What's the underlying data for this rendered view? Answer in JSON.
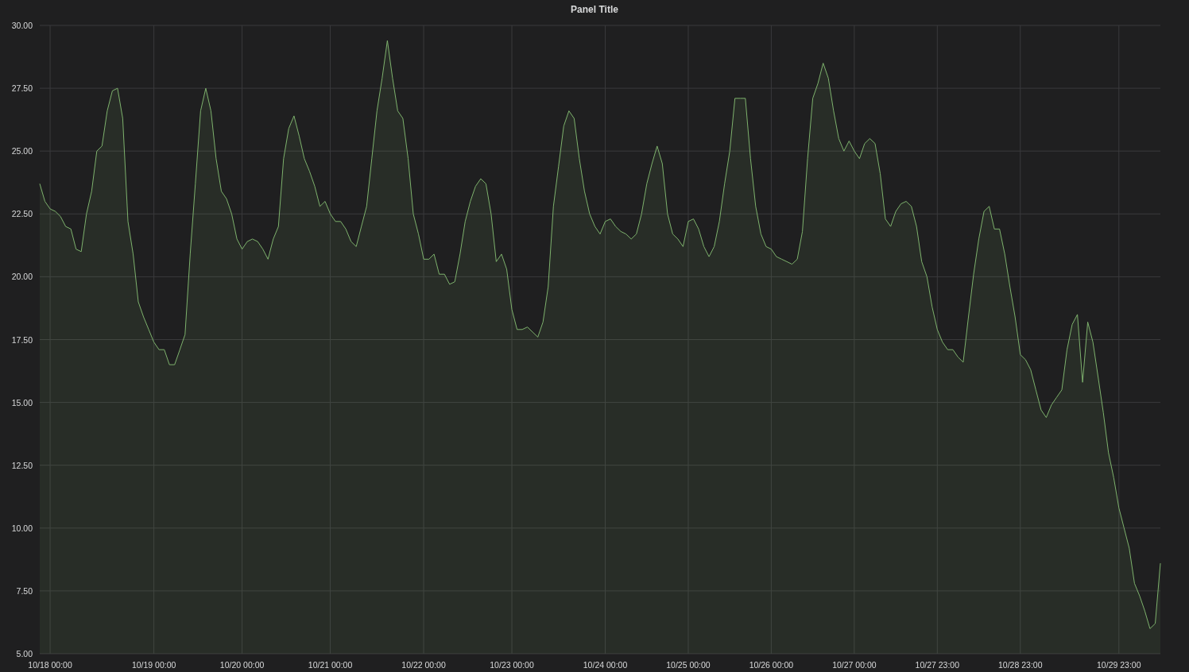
{
  "panel": {
    "chart_data": {
      "type": "area",
      "title": "Panel Title",
      "grid": true,
      "categories": [
        null,
        null,
        "10/18 00:00",
        null,
        null,
        null,
        null,
        null,
        null,
        null,
        null,
        null,
        null,
        null,
        null,
        null,
        null,
        null,
        null,
        null,
        null,
        null,
        "10/19 00:00",
        null,
        null,
        null,
        null,
        null,
        null,
        null,
        null,
        null,
        null,
        null,
        null,
        null,
        null,
        null,
        null,
        "10/20 00:00",
        null,
        null,
        null,
        null,
        null,
        null,
        null,
        null,
        null,
        null,
        null,
        null,
        null,
        null,
        null,
        null,
        "10/21 00:00",
        null,
        null,
        null,
        null,
        null,
        null,
        null,
        null,
        null,
        null,
        null,
        null,
        null,
        null,
        null,
        null,
        null,
        "10/22 00:00",
        null,
        null,
        null,
        null,
        null,
        null,
        null,
        null,
        null,
        null,
        null,
        null,
        null,
        null,
        null,
        null,
        "10/23 00:00",
        null,
        null,
        null,
        null,
        null,
        null,
        null,
        null,
        null,
        null,
        null,
        null,
        null,
        null,
        null,
        null,
        null,
        "10/24 00:00",
        null,
        null,
        null,
        null,
        null,
        null,
        null,
        null,
        null,
        null,
        null,
        null,
        null,
        null,
        null,
        "10/25 00:00",
        null,
        null,
        null,
        null,
        null,
        null,
        null,
        null,
        null,
        null,
        null,
        null,
        null,
        null,
        null,
        "10/26 00:00",
        null,
        null,
        null,
        null,
        null,
        null,
        null,
        null,
        null,
        null,
        null,
        null,
        null,
        null,
        null,
        "10/27 00:00",
        null,
        null,
        null,
        null,
        null,
        null,
        null,
        null,
        null,
        null,
        null,
        null,
        null,
        null,
        null,
        "10/27 23:00",
        null,
        null,
        null,
        null,
        null,
        null,
        null,
        null,
        null,
        null,
        null,
        null,
        null,
        null,
        null,
        "10/28 23:00",
        null,
        null,
        null,
        null,
        null,
        null,
        null,
        null,
        null,
        null,
        null,
        null,
        null,
        null,
        null,
        null,
        null,
        null,
        "10/29 23:00",
        null,
        null,
        null,
        null,
        null,
        null,
        null,
        null
      ],
      "series": [
        {
          "color": "#7eb26d",
          "values": [
            23.7,
            23.0,
            22.7,
            22.6,
            22.4,
            22.0,
            21.9,
            21.1,
            21.0,
            22.5,
            23.4,
            25.0,
            25.2,
            26.6,
            27.4,
            27.5,
            26.3,
            22.2,
            20.9,
            19.0,
            18.4,
            17.9,
            17.4,
            17.1,
            17.1,
            16.5,
            16.5,
            17.1,
            17.7,
            20.9,
            23.7,
            26.6,
            27.5,
            26.6,
            24.7,
            23.4,
            23.1,
            22.5,
            21.5,
            21.1,
            21.4,
            21.5,
            21.4,
            21.1,
            20.7,
            21.5,
            22.0,
            24.7,
            25.9,
            26.4,
            25.6,
            24.7,
            24.2,
            23.6,
            22.8,
            23.0,
            22.5,
            22.2,
            22.2,
            21.9,
            21.4,
            21.2,
            22.0,
            22.8,
            24.7,
            26.6,
            27.9,
            29.4,
            27.9,
            26.6,
            26.3,
            24.7,
            22.5,
            21.7,
            20.7,
            20.7,
            20.9,
            20.1,
            20.1,
            19.7,
            19.8,
            20.9,
            22.2,
            23.0,
            23.6,
            23.9,
            23.7,
            22.5,
            20.6,
            20.9,
            20.3,
            18.7,
            17.9,
            17.9,
            18.0,
            17.8,
            17.6,
            18.2,
            19.6,
            22.8,
            24.4,
            26.0,
            26.6,
            26.3,
            24.7,
            23.4,
            22.5,
            22.0,
            21.7,
            22.2,
            22.3,
            22.0,
            21.8,
            21.7,
            21.5,
            21.7,
            22.5,
            23.7,
            24.5,
            25.2,
            24.5,
            22.5,
            21.7,
            21.5,
            21.2,
            22.2,
            22.3,
            21.9,
            21.2,
            20.8,
            21.2,
            22.2,
            23.7,
            25.0,
            27.1,
            27.1,
            27.1,
            24.7,
            22.8,
            21.7,
            21.2,
            21.1,
            20.8,
            20.7,
            20.6,
            20.5,
            20.7,
            21.8,
            24.7,
            27.1,
            27.7,
            28.5,
            27.9,
            26.6,
            25.5,
            25.0,
            25.4,
            25.0,
            24.7,
            25.3,
            25.5,
            25.3,
            24.1,
            22.3,
            22.0,
            22.6,
            22.9,
            23.0,
            22.8,
            22.0,
            20.6,
            20.0,
            18.8,
            17.9,
            17.4,
            17.1,
            17.1,
            16.8,
            16.6,
            18.4,
            20.1,
            21.5,
            22.6,
            22.8,
            21.9,
            21.9,
            20.9,
            19.6,
            18.4,
            16.9,
            16.7,
            16.3,
            15.5,
            14.7,
            14.4,
            14.9,
            15.2,
            15.5,
            17.1,
            18.1,
            18.5,
            15.8,
            18.2,
            17.4,
            16.0,
            14.6,
            13.0,
            12.0,
            10.8,
            10.0,
            9.2,
            7.8,
            7.3,
            6.7,
            6.0,
            6.2,
            8.6
          ]
        }
      ],
      "ylim": [
        5,
        30
      ],
      "yticks": [
        {
          "value": 5,
          "label": "5.00"
        },
        {
          "value": 7.5,
          "label": "7.50"
        },
        {
          "value": 10,
          "label": "10.00"
        },
        {
          "value": 12.5,
          "label": "12.50"
        },
        {
          "value": 15,
          "label": "15.00"
        },
        {
          "value": 17.5,
          "label": "17.50"
        },
        {
          "value": 20,
          "label": "20.00"
        },
        {
          "value": 22.5,
          "label": "22.50"
        },
        {
          "value": 25,
          "label": "25.00"
        },
        {
          "value": 27.5,
          "label": "27.50"
        },
        {
          "value": 30,
          "label": "30.00"
        }
      ]
    }
  }
}
